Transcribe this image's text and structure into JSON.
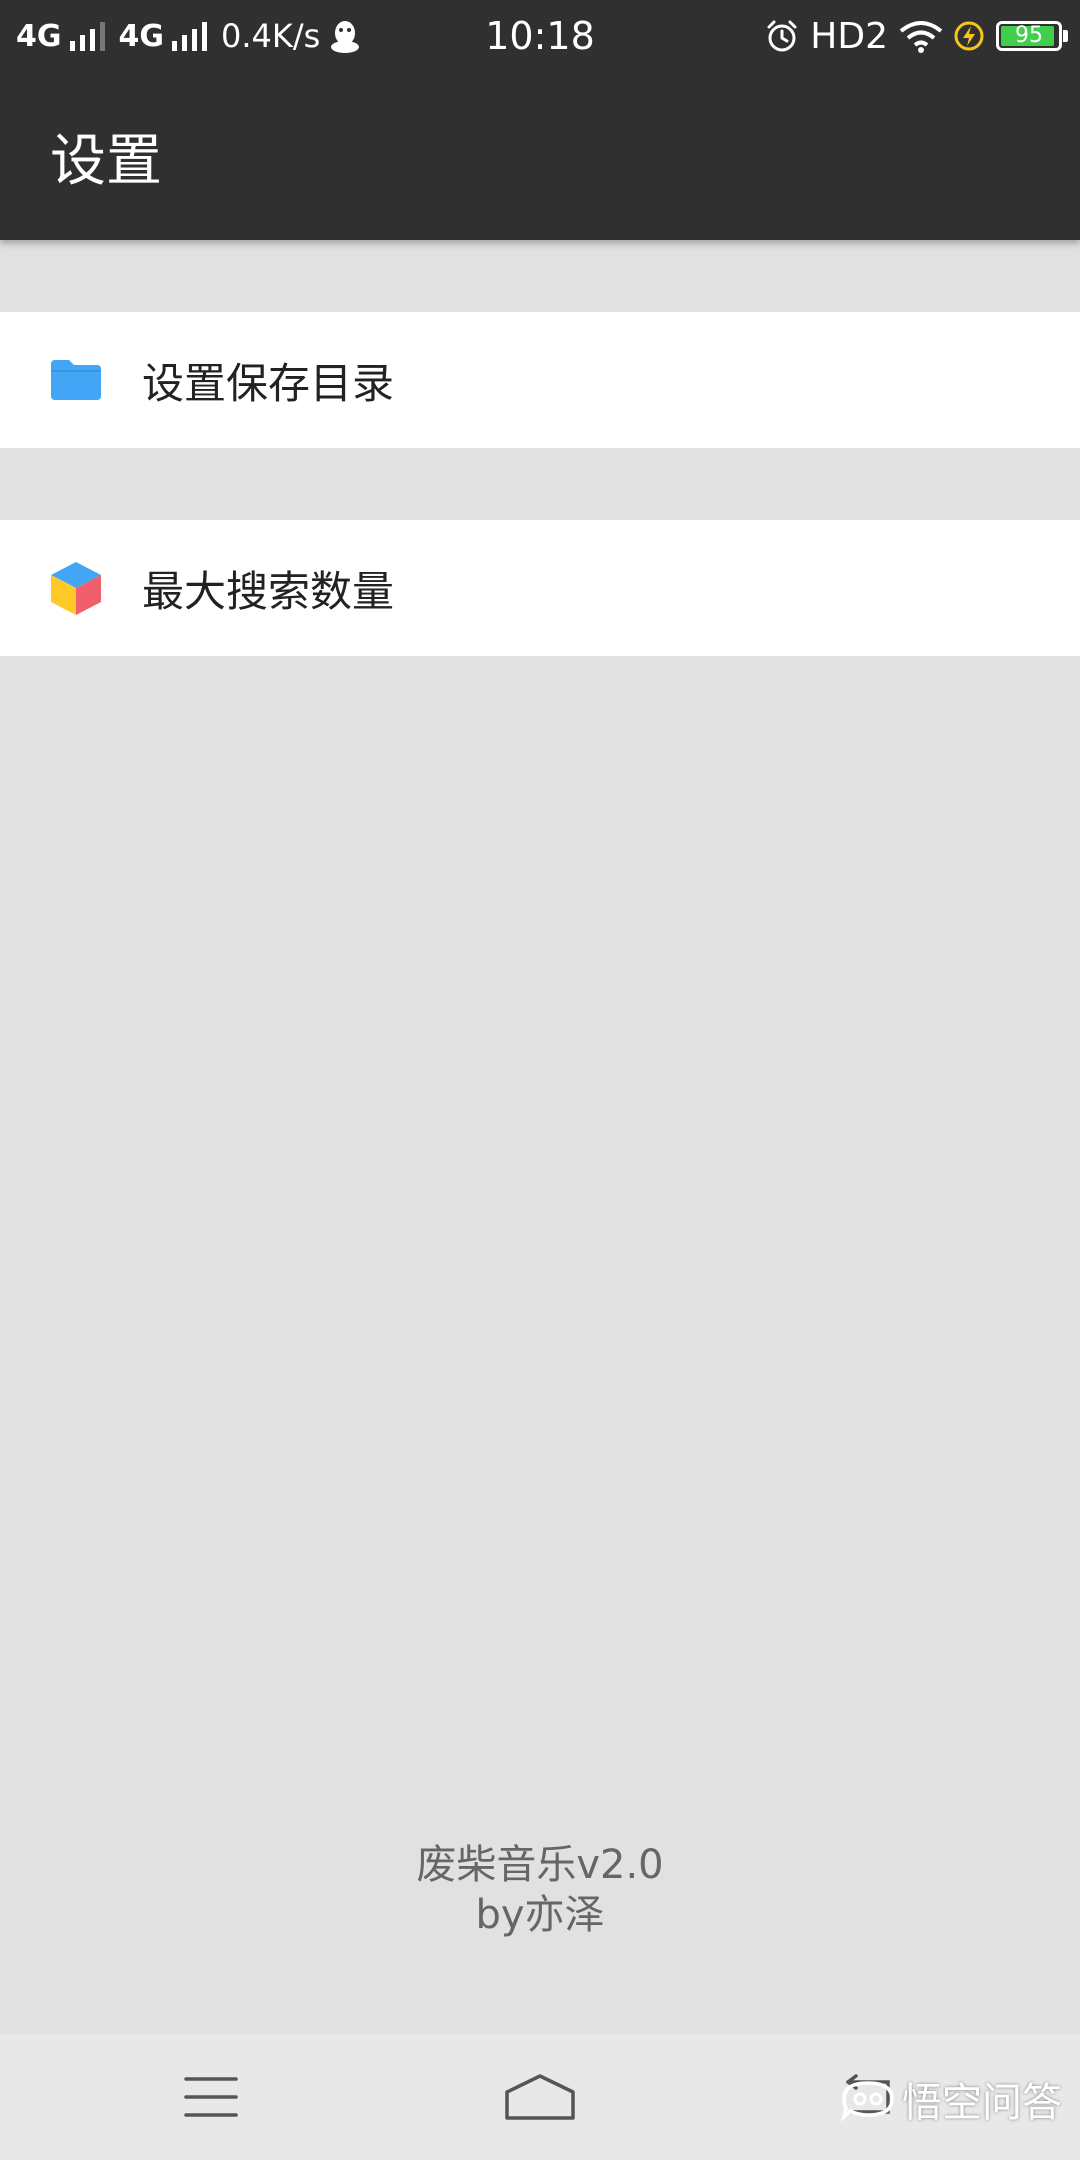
{
  "status_bar": {
    "network1": "4G",
    "network2": "4G",
    "speed": "0.4K/s",
    "time": "10:18",
    "hd": "HD2",
    "battery_level": "95",
    "battery_fill": 0.95
  },
  "app_bar": {
    "title": "设置"
  },
  "settings": [
    {
      "label": "设置保存目录",
      "icon": "folder-icon"
    },
    {
      "label": "最大搜索数量",
      "icon": "cube-icon"
    }
  ],
  "footer": {
    "app_name": "废柴音乐v2.0",
    "author": "by亦泽"
  },
  "watermark": {
    "text": "悟空问答"
  },
  "colors": {
    "bar_background": "#303030",
    "page_background": "#e1e1e1",
    "folder_blue": "#42a5f5",
    "battery_green": "#3fcf4a"
  }
}
